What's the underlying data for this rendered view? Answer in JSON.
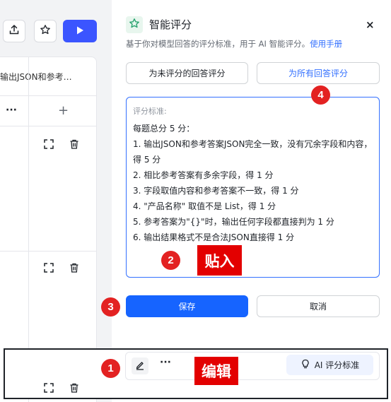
{
  "left_table": {
    "column_header": "输出JSON和参考…",
    "more_label": "···",
    "add_label": "+"
  },
  "panel": {
    "title": "智能评分",
    "close_label": "×",
    "description": "基于你对模型回答的评分标准，用于 AI 智能评分。",
    "manual_link": "使用手册",
    "score_unscored_label": "为未评分的回答评分",
    "score_all_label": "为所有回答评分",
    "criteria_label": "评分标准:",
    "criteria_lines": [
      "每题总分 5 分：",
      "1. 输出JSON和参考答案JSON完全一致，没有冗余字段和内容，得 5 分",
      "2. 相比参考答案有多余字段，得 1 分",
      "3. 字段取值内容和参考答案不一致，得 1 分",
      "4. \"产品名称\" 取值不是 List，得 1 分",
      "5. 参考答案为\"{}\"时，输出任何字段都直接判为 1 分",
      "6. 输出结果格式不是合法JSON直接得 1 分"
    ],
    "save_label": "保存",
    "cancel_label": "取消"
  },
  "annotations": {
    "badge_1": "1",
    "badge_2": "2",
    "badge_3": "3",
    "badge_4": "4",
    "paste_tag": "贴入",
    "edit_tag": "编辑"
  },
  "bottom_toolbar": {
    "more_label": "···",
    "ai_criteria_label": "AI 评分标准"
  },
  "colors": {
    "primary": "#1664ff",
    "link": "#3370ff",
    "annotation_red": "#e32222",
    "title_icon_green": "#2ba471"
  },
  "icons": {
    "left_toolbar": [
      "upload-icon",
      "star-icon",
      "play-icon"
    ],
    "table": [
      "expand-icon",
      "trash-icon"
    ],
    "panel": [
      "star-icon",
      "close-icon"
    ],
    "bottom": [
      "edit-icon",
      "more-icon",
      "bulb-icon"
    ]
  }
}
